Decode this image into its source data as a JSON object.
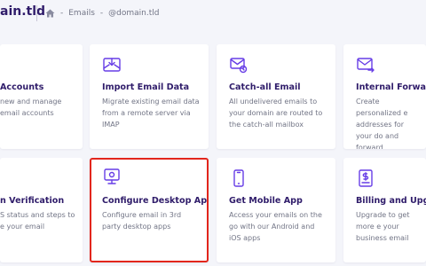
{
  "header": {
    "domain": "ain.tld",
    "breadcrumb": [
      "Emails",
      "@domain.tld"
    ],
    "separator": "-"
  },
  "cards": [
    {
      "title": "Accounts",
      "desc": "new and manage email accounts",
      "icon": "accounts-icon"
    },
    {
      "title": "Import Email Data",
      "desc": "Migrate existing email data from a remote server via IMAP",
      "icon": "import-mail-icon"
    },
    {
      "title": "Catch-all Email",
      "desc": "All undelivered emails to your domain are routed to the catch-all mailbox",
      "icon": "catch-all-icon"
    },
    {
      "title": "Internal Forwarding",
      "desc": "Create personalized e addresses for your do and forward",
      "icon": "forward-mail-icon"
    },
    {
      "title": "n Verification",
      "desc": "S status and steps to e your email",
      "icon": "verification-icon"
    },
    {
      "title": "Configure Desktop App",
      "desc": "Configure email in 3rd party desktop apps",
      "icon": "desktop-icon"
    },
    {
      "title": "Get Mobile App",
      "desc": "Access your emails on the go with our Android and iOS apps",
      "icon": "mobile-icon"
    },
    {
      "title": "Billing and Upgrade",
      "desc": "Upgrade to get more e your business email",
      "icon": "billing-icon"
    }
  ],
  "colors": {
    "accent": "#673de6",
    "highlight": "#e2261c",
    "title": "#2f1c6a",
    "text": "#727586",
    "bg": "#f4f5fa"
  }
}
